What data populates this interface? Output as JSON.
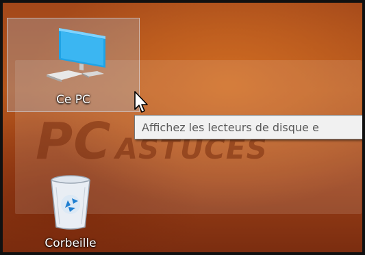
{
  "desktop": {
    "items": [
      {
        "label": "Ce PC",
        "icon": "computer-icon",
        "selected": true
      },
      {
        "label": "Corbeille",
        "icon": "recycle-bin-icon",
        "selected": false
      }
    ]
  },
  "tooltip": {
    "text": "Affichez les lecteurs de disque e"
  },
  "watermark": {
    "logo_text": "PC",
    "brand_text": "ASTUCES"
  },
  "colors": {
    "wallpaper": "#a3481a",
    "selection": "#aac8eb",
    "tooltip_bg": "#f1f1f1",
    "monitor_blue": "#1fa3e6"
  }
}
